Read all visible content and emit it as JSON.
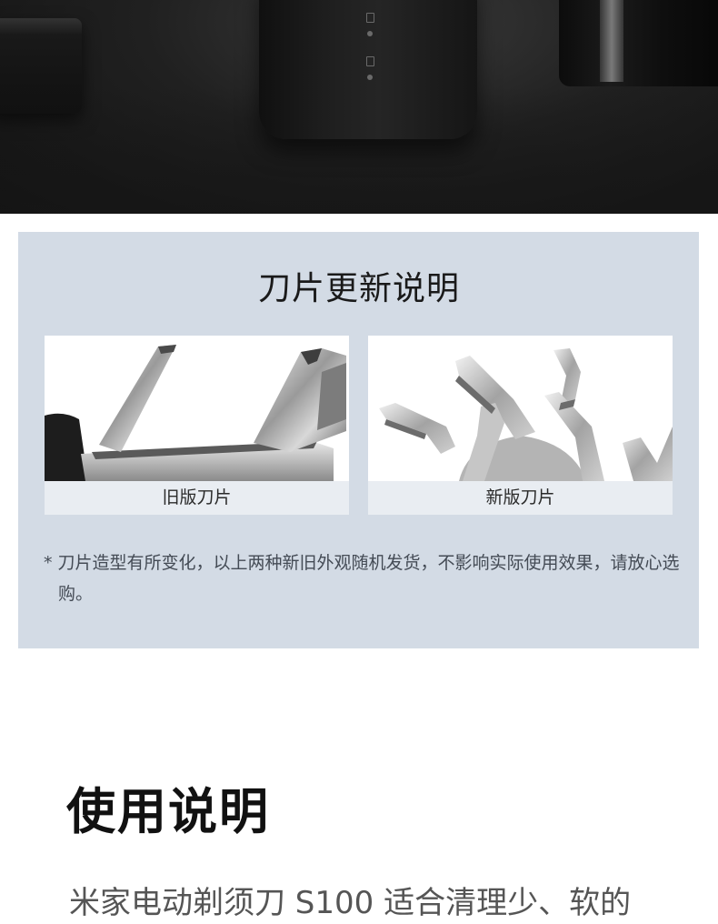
{
  "blade_update": {
    "title": "刀片更新说明",
    "old_blade_label": "旧版刀片",
    "new_blade_label": "新版刀片",
    "note": "* 刀片造型有所变化，以上两种新旧外观随机发货，不影响实际使用效果，请放心选购。"
  },
  "usage": {
    "title": "使用说明",
    "body_partial": "米家电动剃须刀 S100 适合清理少、软的"
  },
  "colors": {
    "panel_background": "#d3dbe5",
    "caption_background": "#e9edf2",
    "title_text": "#1a1a1a",
    "note_text": "#444b55",
    "hero_background": "#1a1a1a"
  }
}
